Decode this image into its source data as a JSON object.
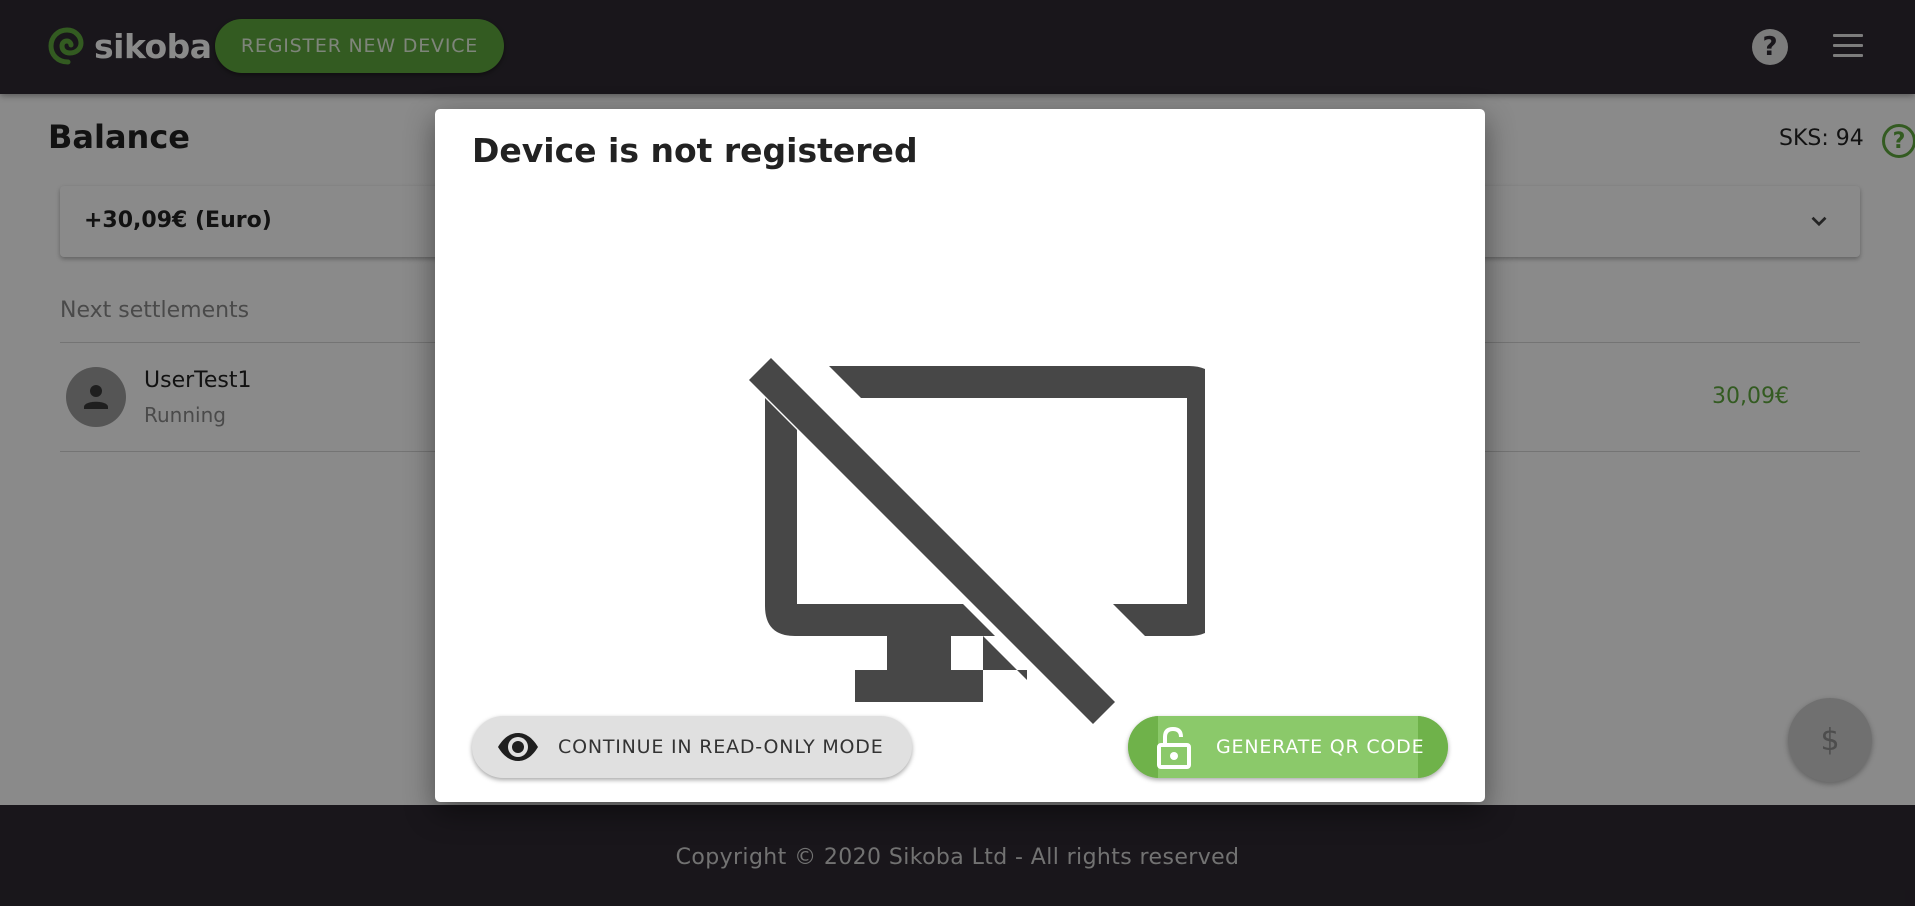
{
  "header": {
    "logo_text": "sikoba",
    "register_button": "REGISTER NEW DEVICE",
    "help_icon": "help-circle-icon",
    "menu_icon": "hamburger-menu-icon"
  },
  "balance": {
    "title": "Balance",
    "sks_label": "SKS: 94",
    "amount": "+30,09€ (Euro)"
  },
  "settlements": {
    "heading": "Next settlements",
    "items": [
      {
        "name": "UserTest1",
        "status": "Running",
        "amount": "30,09€"
      }
    ]
  },
  "fab": {
    "symbol": "$",
    "icon": "dollar-icon"
  },
  "footer": {
    "text": "Copyright © 2020 Sikoba Ltd - All rights reserved"
  },
  "dialog": {
    "title": "Device is not registered",
    "icon": "monitor-off-icon",
    "readonly_button": "CONTINUE IN READ-ONLY MODE",
    "qr_button": "GENERATE QR CODE"
  },
  "colors": {
    "header_bg": "#2f2a32",
    "accent_green": "#5fa83e",
    "qr_button_bg": "#8bc96a"
  }
}
